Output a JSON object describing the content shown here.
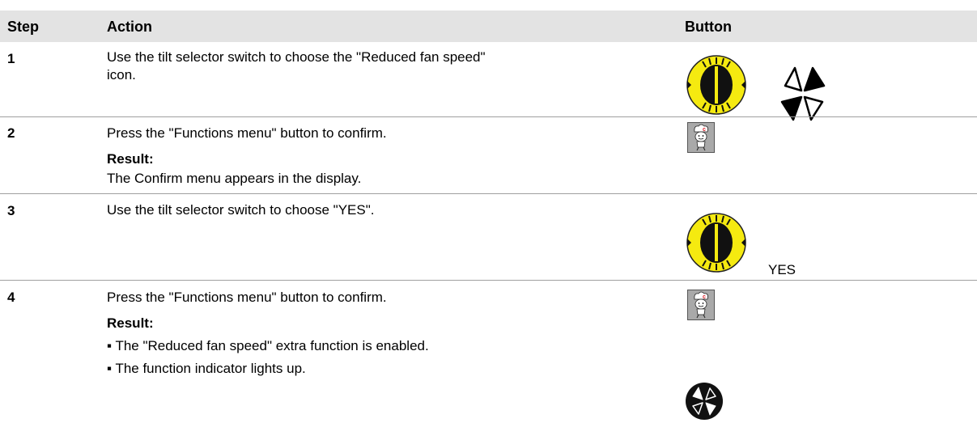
{
  "table": {
    "headers": {
      "step": "Step",
      "action": "Action",
      "button": "Button"
    },
    "rows": [
      {
        "step": "1",
        "action_line1": "Use the tilt selector switch to choose the \"Reduced fan speed\"",
        "action_line2": "icon.",
        "button_icons": [
          "tilt-selector-knob",
          "reduced-fan-speed-icon"
        ]
      },
      {
        "step": "2",
        "action": "Press the \"Functions menu\" button to confirm.",
        "result_label": "Result:",
        "result": "The Confirm menu appears in the display.",
        "button_icons": [
          "functions-menu-chef-button"
        ]
      },
      {
        "step": "3",
        "action": "Use the tilt selector switch to choose \"YES\".",
        "button_label": "YES",
        "button_icons": [
          "tilt-selector-knob"
        ]
      },
      {
        "step": "4",
        "action": "Press the \"Functions menu\" button to confirm.",
        "result_label": "Result:",
        "results": [
          "▪ The \"Reduced fan speed\" extra function is enabled.",
          "▪ The function indicator lights up."
        ],
        "button_icons": [
          "functions-menu-chef-button",
          "function-indicator-fan-icon"
        ]
      }
    ]
  },
  "colors": {
    "header_bg": "#e3e3e3",
    "knob_yellow": "#f5ea10",
    "chef_bg": "#a9a9a9",
    "chef_accent": "#e0202a"
  }
}
